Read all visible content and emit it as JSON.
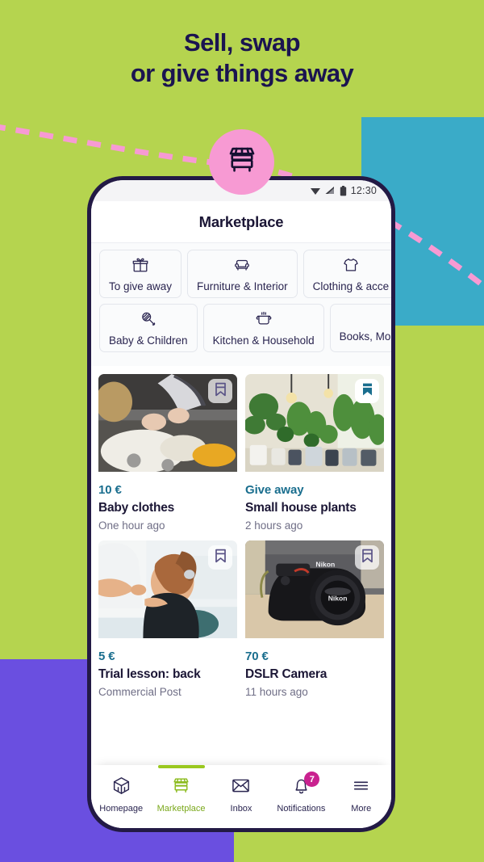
{
  "palette": {
    "background_lime": "#b5d44f",
    "block_teal": "#3aabc8",
    "block_purple": "#6a4fe0",
    "badge_pink": "#f79ad3",
    "dashed_line_pink": "#f79ad3",
    "headline_navy": "#1b1450",
    "price_teal": "#1a6e8e",
    "accent_green": "#9ac81f",
    "notification_magenta": "#c9228f",
    "phone_frame": "#231a45"
  },
  "promo": {
    "headline_line1": "Sell, swap",
    "headline_line2": "or give things away",
    "badge_icon": "market-stall-icon"
  },
  "status_bar": {
    "time": "12:30",
    "icons": [
      "wifi-icon",
      "cell-signal-icon",
      "battery-icon"
    ]
  },
  "app_bar": {
    "title": "Marketplace"
  },
  "categories": {
    "row1": [
      {
        "label": "To give away",
        "icon": "gift-icon"
      },
      {
        "label": "Furniture & Interior",
        "icon": "armchair-icon"
      },
      {
        "label": "Clothing & acce",
        "icon": "tshirt-icon"
      }
    ],
    "row2": [
      {
        "label": "Baby & Children",
        "icon": "rattle-icon"
      },
      {
        "label": "Kitchen & Household",
        "icon": "cooking-pot-icon"
      },
      {
        "label": "Books, Mo",
        "icon": "book-icon"
      }
    ]
  },
  "listings": [
    {
      "price": "10 €",
      "title": "Baby clothes",
      "meta": "One hour ago",
      "bookmarked": false,
      "image": "baby-clothes-photo"
    },
    {
      "price": "Give away",
      "title": "Small house plants",
      "meta": "2 hours ago",
      "bookmarked": true,
      "image": "house-plants-photo"
    },
    {
      "price": "5 €",
      "title": "Trial lesson: back",
      "meta": "Commercial Post",
      "bookmarked": false,
      "image": "massage-photo"
    },
    {
      "price": "70 €",
      "title": "DSLR Camera",
      "meta": "11 hours ago",
      "bookmarked": false,
      "image": "dslr-camera-photo"
    }
  ],
  "bottom_nav": [
    {
      "label": "Homepage",
      "icon": "home-cube-icon",
      "active": false,
      "badge": ""
    },
    {
      "label": "Marketplace",
      "icon": "market-stall-icon",
      "active": true,
      "badge": ""
    },
    {
      "label": "Inbox",
      "icon": "envelope-icon",
      "active": false,
      "badge": ""
    },
    {
      "label": "Notifications",
      "icon": "bell-icon",
      "active": false,
      "badge": "7"
    },
    {
      "label": "More",
      "icon": "hamburger-icon",
      "active": false,
      "badge": ""
    }
  ]
}
